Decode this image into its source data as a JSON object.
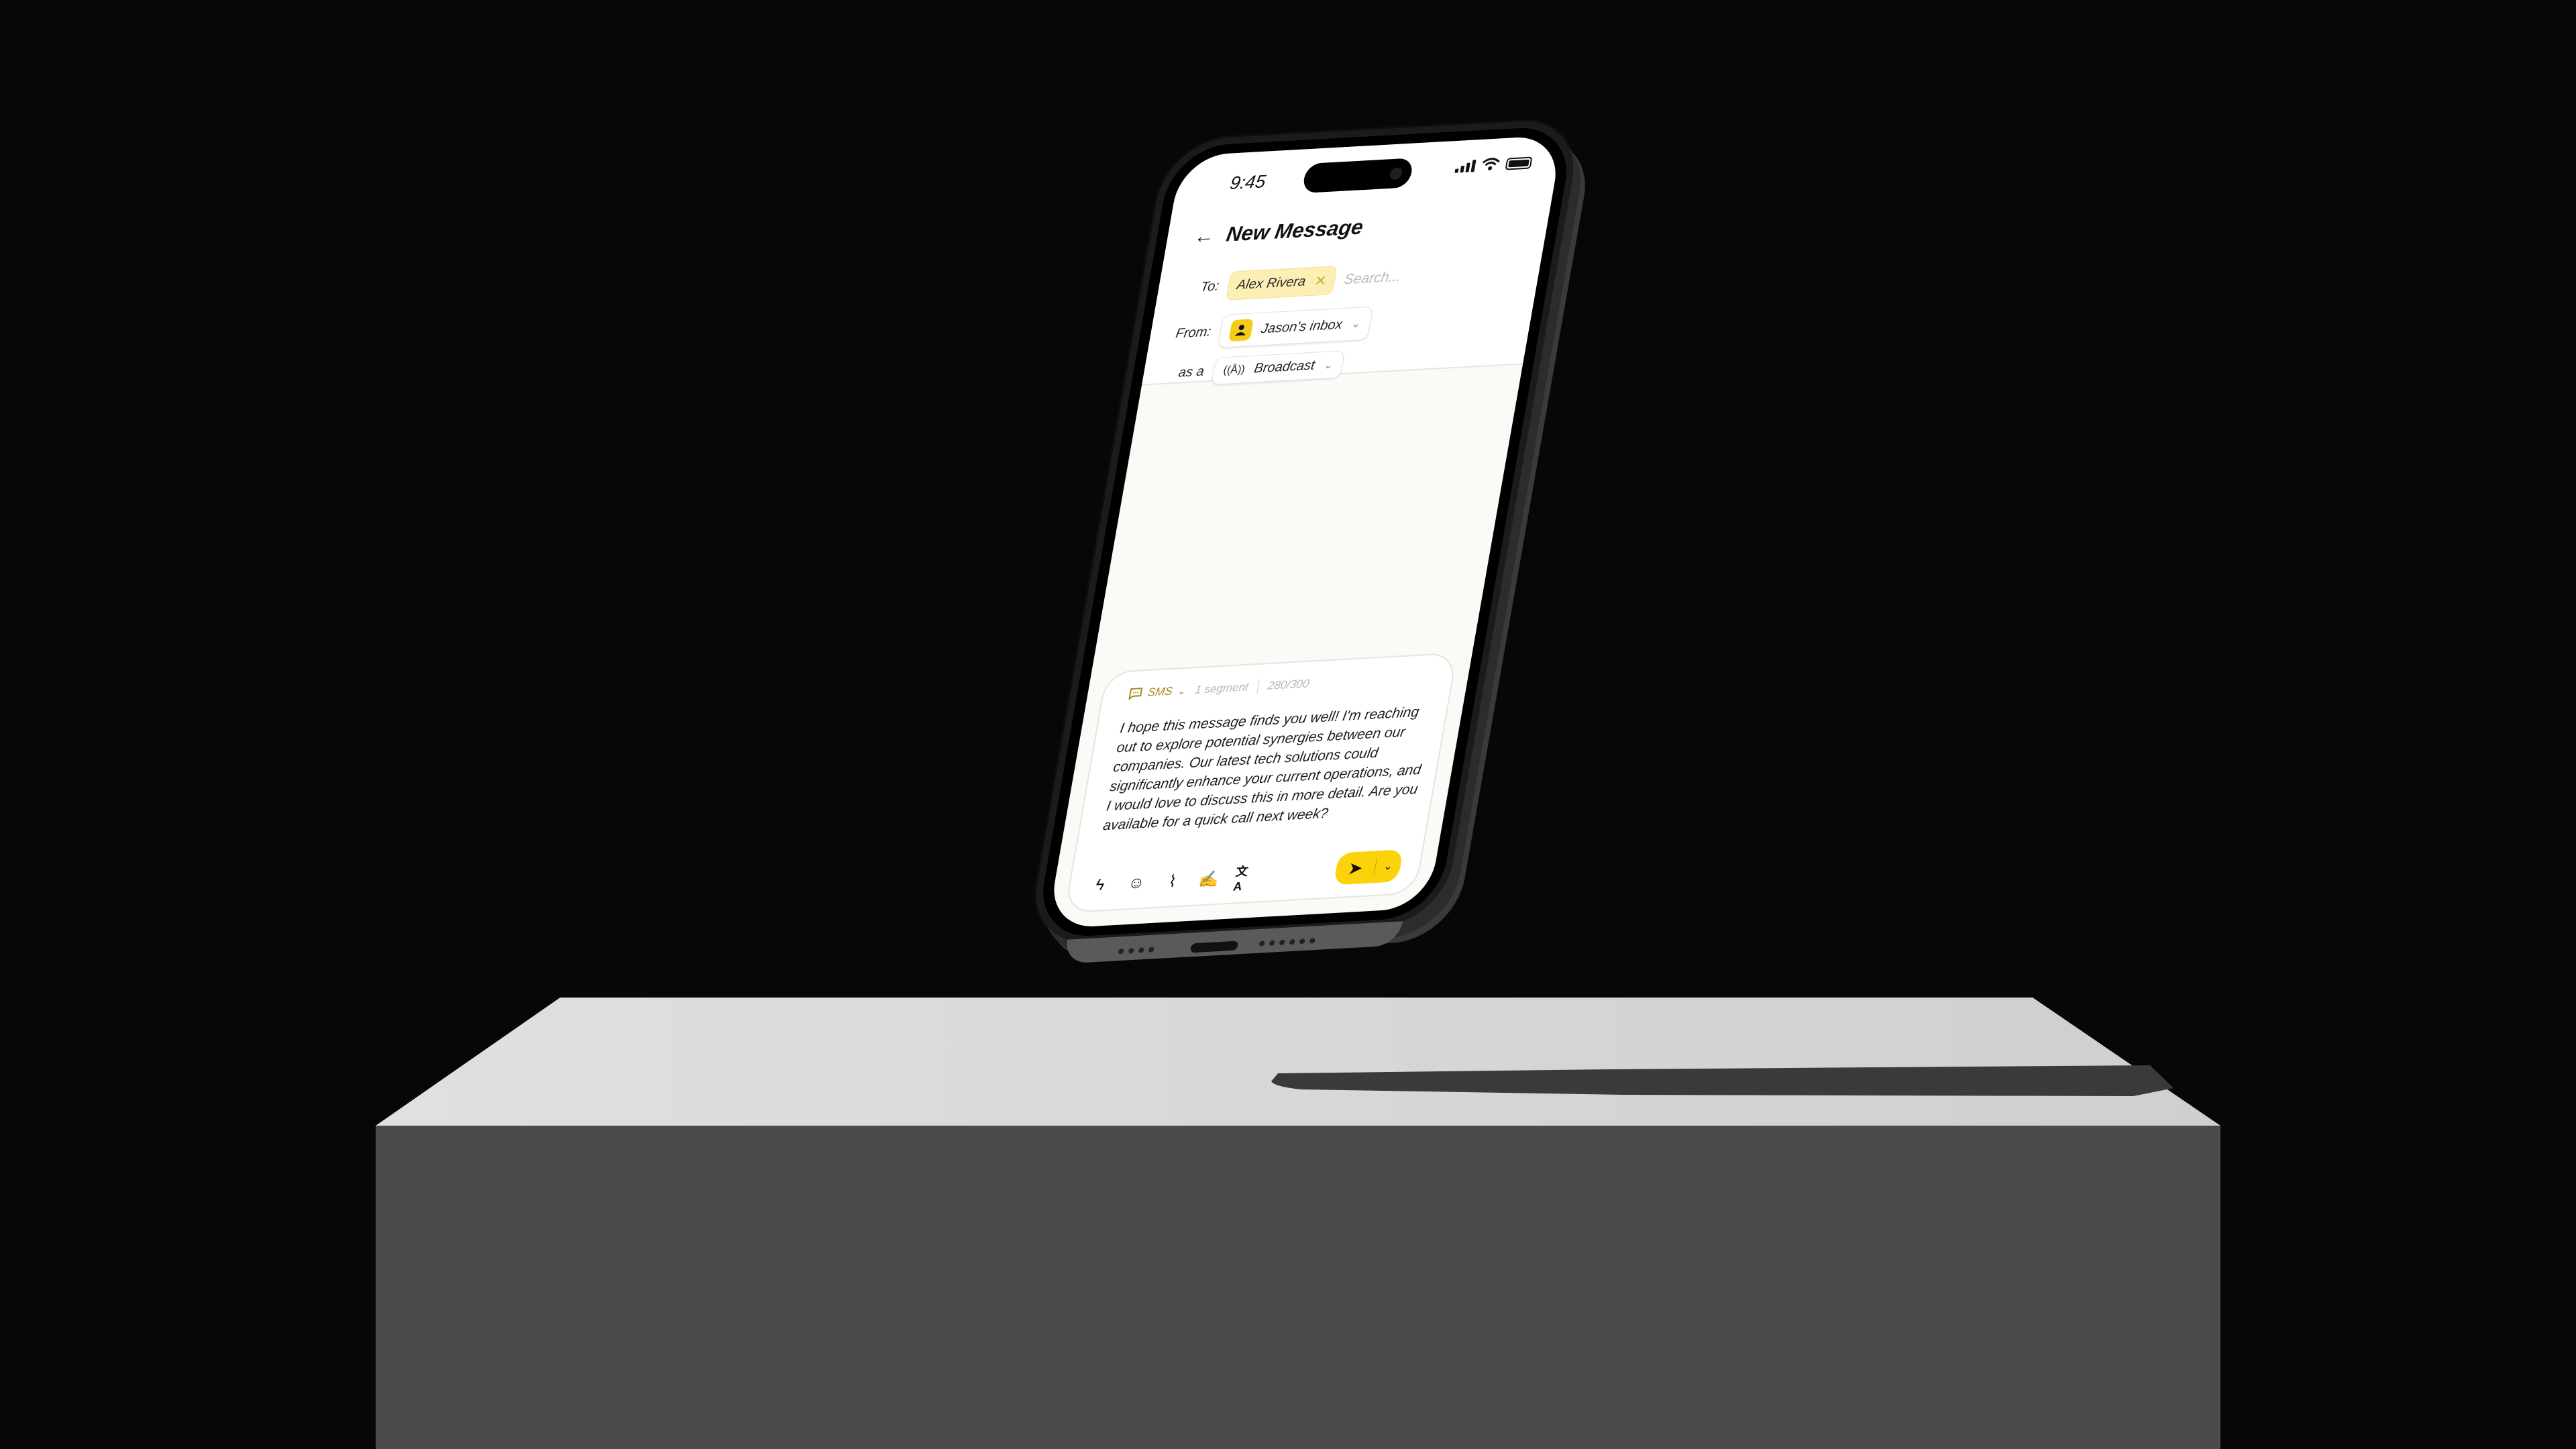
{
  "scene": {
    "background_color": "#070708",
    "pedestal_top_color": "#d6d6d6",
    "pedestal_front_color": "#4b4b4b",
    "shadow_color": "#3a3a3a"
  },
  "status_bar": {
    "time": "9:45"
  },
  "header": {
    "title": "New Message",
    "back_icon": "arrow-left-icon"
  },
  "to": {
    "label": "To:",
    "recipient": "Alex Rivera",
    "remove_icon": "close-icon",
    "search_placeholder": "Search..."
  },
  "from": {
    "label": "From:",
    "inbox": "Jason's inbox",
    "icon": "user-icon"
  },
  "as": {
    "label": "as a",
    "type": "Broadcast",
    "icon": "broadcast-icon"
  },
  "composer": {
    "channel": "SMS",
    "segments": "1 segment",
    "char_count": "280/300",
    "message": "I hope this message finds you well! I'm reaching out to explore potential synergies between our companies. Our latest tech solutions could significantly enhance your current operations, and I would love to discuss this in more detail. Are you available for a quick call next week?",
    "tools": [
      {
        "name": "lightning-icon",
        "glyph": "ϟ"
      },
      {
        "name": "emoji-icon",
        "glyph": "☺"
      },
      {
        "name": "paperclip-icon",
        "glyph": "⌇"
      },
      {
        "name": "signature-icon",
        "glyph": "✍"
      },
      {
        "name": "translate-icon",
        "glyph": "文A"
      }
    ],
    "send_icon": "send-icon"
  },
  "colors": {
    "accent": "#fcd20a",
    "chip_bg": "#fcefb5",
    "sms_gold": "#a6861a"
  }
}
